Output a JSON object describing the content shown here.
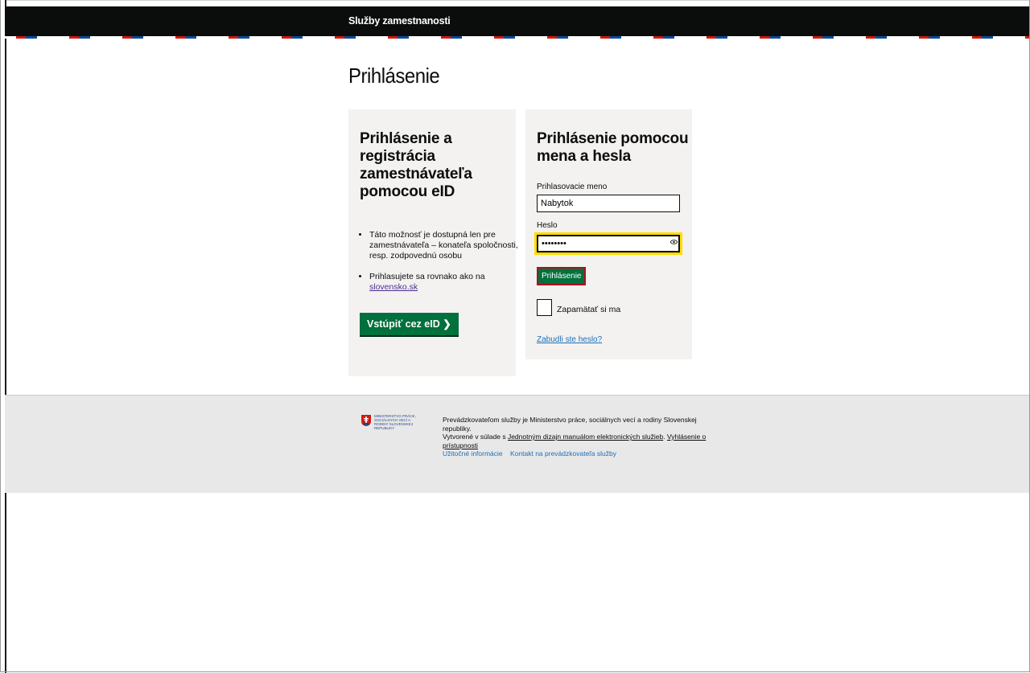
{
  "header": {
    "title": "Služby zamestnanosti"
  },
  "page": {
    "title": "Prihlásenie"
  },
  "eid_panel": {
    "heading": "Prihlásenie a registrácia zamestnávateľa pomocou eID",
    "note1": "Táto možnosť je dostupná len pre zamestnávateľa – konateľa spoločnosti, resp. zodpovednú osobu",
    "note2_prefix": "Prihlasujete sa rovnako ako na ",
    "note2_link": "slovensko.sk",
    "button_label": "Vstúpiť cez eID ❯"
  },
  "login_panel": {
    "heading": "Prihlásenie pomocou mena a hesla",
    "username_label": "Prihlasovacie meno",
    "username_value": "Nabytok",
    "password_label": "Heslo",
    "password_value": "••••••••",
    "submit_label": "Prihlásenie",
    "remember_label": "Zapamätať si ma",
    "forgot_link": "Zabudli ste heslo?"
  },
  "footer": {
    "logo_text": "Ministerstvo práce, sociálnych vecí a rodiny Slovenskej republiky",
    "operator_text": "Prevádzkovateľom služby je Ministerstvo práce, sociálnych vecí a rodiny Slovenskej republiky.",
    "created_prefix": "Vytvorené v súlade s ",
    "design_manual_link": "Jednotným dizajn manuálom elektronických služieb",
    "accessibility_link": "Vyhlásenie o prístupnosti",
    "links": [
      "Užitočné informácie",
      "Kontakt na prevádzkovateľa služby"
    ]
  },
  "colors": {
    "primary_green": "#00703c",
    "header_black": "#0b0c0c",
    "focus_yellow": "#ffdd00",
    "stripe_red": "#d0190f",
    "stripe_blue": "#0b4a9c"
  }
}
